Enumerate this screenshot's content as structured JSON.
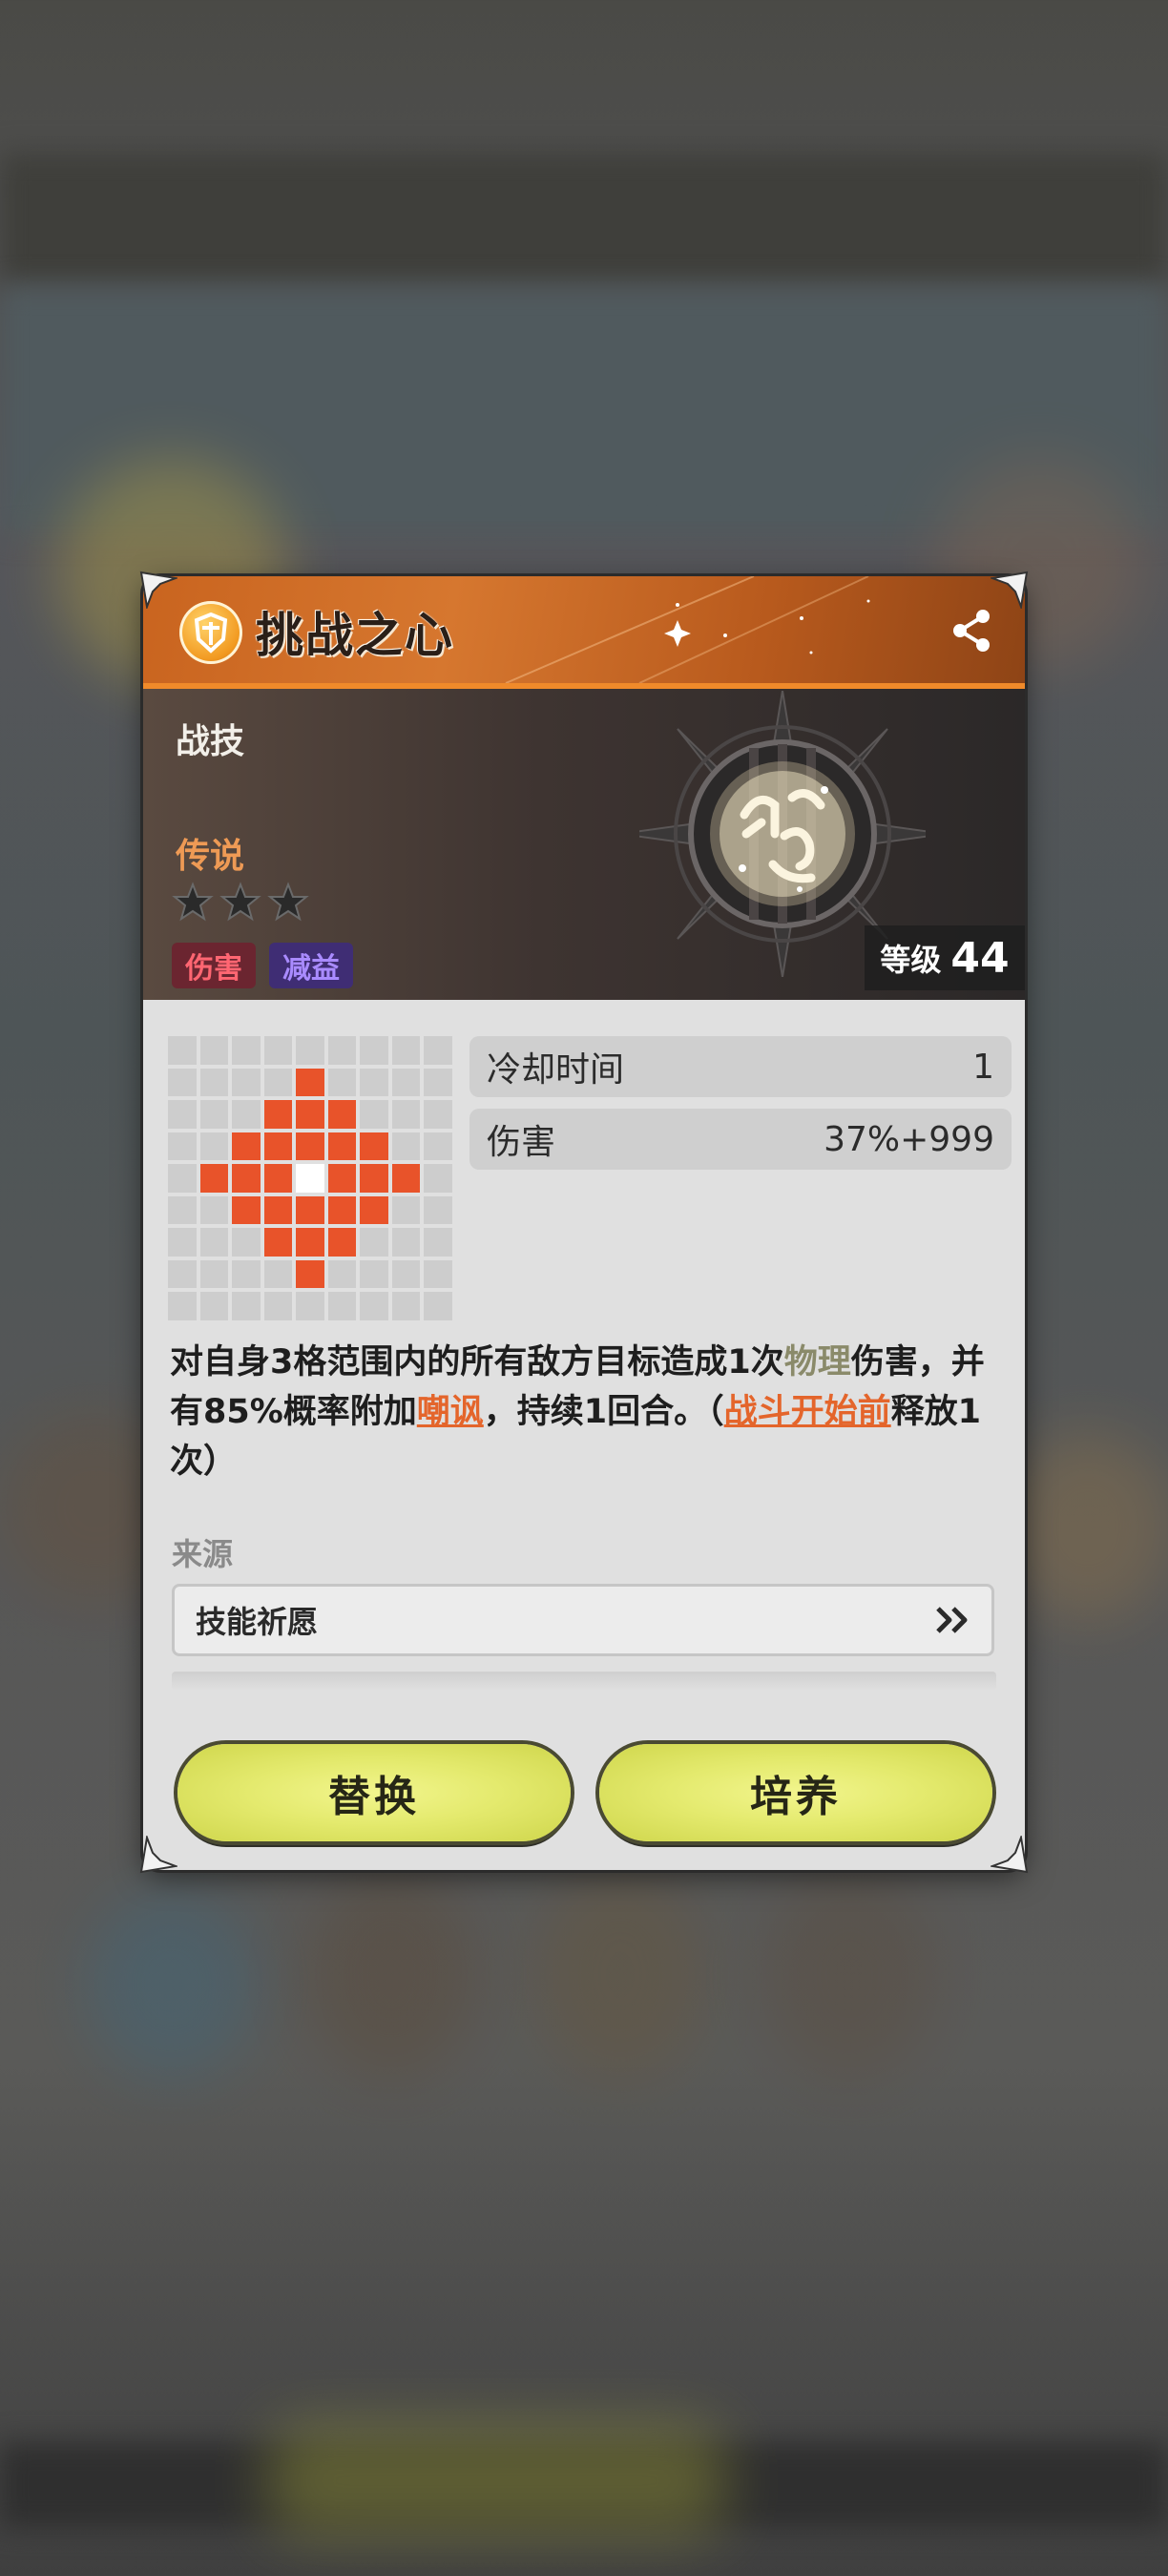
{
  "skill": {
    "title": "挑战之心",
    "category": "战技",
    "rarity": "传说",
    "stars": 3,
    "tags": {
      "damage": "伤害",
      "debuff": "减益"
    },
    "level_label": "等级",
    "level_value": "44"
  },
  "stats": {
    "cooldown_label": "冷却时间",
    "cooldown_value": "1",
    "damage_label": "伤害",
    "damage_value": "37%+999"
  },
  "range_grid": {
    "size": 9,
    "hit_cells": [
      [
        1,
        4
      ],
      [
        2,
        3
      ],
      [
        2,
        4
      ],
      [
        2,
        5
      ],
      [
        3,
        2
      ],
      [
        3,
        3
      ],
      [
        3,
        4
      ],
      [
        3,
        5
      ],
      [
        3,
        6
      ],
      [
        4,
        1
      ],
      [
        4,
        2
      ],
      [
        4,
        3
      ],
      [
        4,
        5
      ],
      [
        4,
        6
      ],
      [
        4,
        7
      ],
      [
        5,
        2
      ],
      [
        5,
        3
      ],
      [
        5,
        4
      ],
      [
        5,
        5
      ],
      [
        5,
        6
      ],
      [
        6,
        3
      ],
      [
        6,
        4
      ],
      [
        6,
        5
      ],
      [
        7,
        4
      ]
    ],
    "self_cell": [
      4,
      4
    ]
  },
  "description": {
    "p1": "对自身3格范围内的所有敌方目标造成1次",
    "kw1": "物理",
    "p2": "伤害，并有85%概率附加",
    "kw2": "嘲讽",
    "p3": "，持续1回合。（",
    "kw3": "战斗开始前",
    "p4": "释放1次）"
  },
  "source": {
    "label": "来源",
    "value": "技能祈愿"
  },
  "buttons": {
    "replace": "替换",
    "train": "培养"
  },
  "colors": {
    "header": "#d6772f",
    "hit": "#e8532a",
    "button": "#e4ea6e",
    "rarity": "#ee9a55"
  },
  "icons": [
    "skill-type-icon",
    "share-icon",
    "star-icon",
    "skill-emblem-icon",
    "double-chevron-right-icon"
  ]
}
